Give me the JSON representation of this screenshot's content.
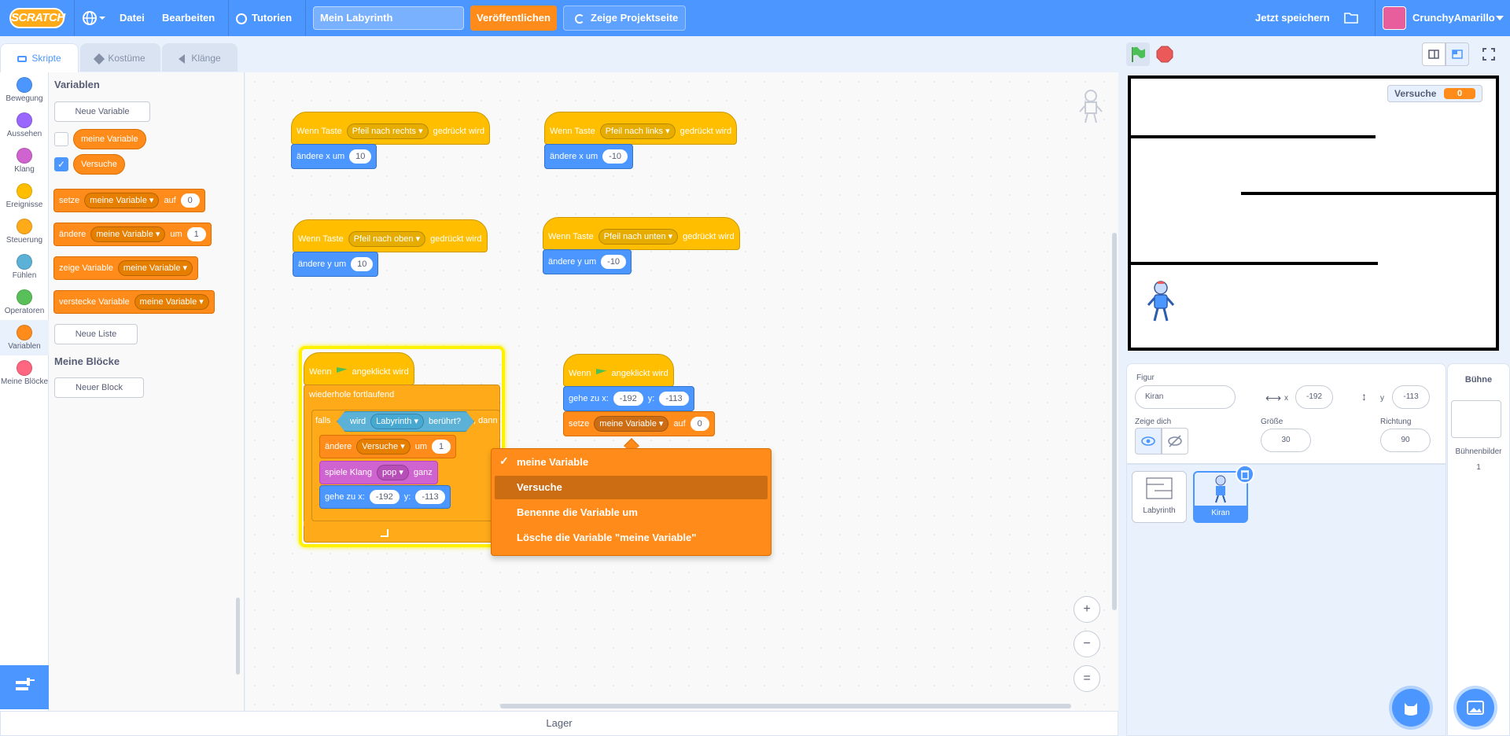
{
  "menubar": {
    "logo": "SCRATCH",
    "file": "Datei",
    "edit": "Bearbeiten",
    "tutorials": "Tutorien",
    "project_title": "Mein Labyrinth",
    "share": "Veröffentlichen",
    "see_project": "Zeige Projektseite",
    "save_now": "Jetzt speichern",
    "username": "CrunchyAmarillo"
  },
  "tabs": {
    "code": "Skripte",
    "costumes": "Kostüme",
    "sounds": "Klänge"
  },
  "categories": [
    "Bewegung",
    "Aussehen",
    "Klang",
    "Ereignisse",
    "Steuerung",
    "Fühlen",
    "Operatoren",
    "Variablen",
    "Meine Blöcke"
  ],
  "category_colors": [
    "#4c97ff",
    "#9966ff",
    "#cf63cf",
    "#ffbf00",
    "#ffab19",
    "#5cb1d6",
    "#59c059",
    "#ff8c1a",
    "#ff6680"
  ],
  "palette": {
    "heading_vars": "Variablen",
    "new_variable": "Neue Variable",
    "var1": "meine Variable",
    "var2": "Versuche",
    "set_block": {
      "word": "setze",
      "var": "meine Variable",
      "to": "auf",
      "value": "0"
    },
    "change_block": {
      "word": "ändere",
      "var": "meine Variable",
      "by": "um",
      "value": "1"
    },
    "show_block": {
      "word": "zeige Variable",
      "var": "meine Variable"
    },
    "hide_block": {
      "word": "verstecke Variable",
      "var": "meine Variable"
    },
    "new_list": "Neue Liste",
    "heading_my_blocks": "Meine Blöcke",
    "new_block": "Neuer Block"
  },
  "scripts": {
    "when_key": "Wenn Taste",
    "pressed": "gedrückt wird",
    "key_right": "Pfeil nach rechts",
    "key_left": "Pfeil nach links",
    "key_up": "Pfeil nach oben",
    "key_down": "Pfeil nach unten",
    "change_x": "ändere x um",
    "change_y": "ändere y um",
    "val_10": "10",
    "val_m10": "-10",
    "when": "Wenn",
    "clicked": "angeklickt wird",
    "forever": "wiederhole fortlaufend",
    "if": "falls",
    "then": ", dann",
    "touching_prefix": "wird",
    "touching_target": "Labyrinth",
    "touching_suffix": "berührt?",
    "change_word": "ändere",
    "change_var": "Versuche",
    "by": "um",
    "val_1": "1",
    "play_sound": "spiele Klang",
    "sound_name": "pop",
    "until_done": "ganz",
    "goto": "gehe zu x:",
    "y": "y:",
    "x_val": "-192",
    "y_val": "-113",
    "set_word": "setze",
    "set_var": "meine Variable",
    "to": "auf",
    "val_0": "0"
  },
  "context_menu": {
    "check": "✓",
    "items": [
      "meine Variable",
      "Versuche",
      "Benenne die Variable um",
      "Lösche die Variable \"meine Variable\""
    ]
  },
  "zoom": {
    "in": "+",
    "out": "−",
    "reset": "="
  },
  "stage": {
    "monitor_label": "Versuche",
    "monitor_value": "0"
  },
  "sprite_info": {
    "sprite_label": "Figur",
    "sprite_name": "Kiran",
    "x_label": "x",
    "x_value": "-192",
    "y_label": "y",
    "y_value": "-113",
    "show_label": "Zeige dich",
    "size_label": "Größe",
    "size_value": "30",
    "direction_label": "Richtung",
    "direction_value": "90"
  },
  "sprites": [
    "Labyrinth",
    "Kiran"
  ],
  "stage_panel": {
    "title": "Bühne",
    "backdrops_label": "Bühnenbilder",
    "backdrops_count": "1"
  },
  "backpack": "Lager"
}
